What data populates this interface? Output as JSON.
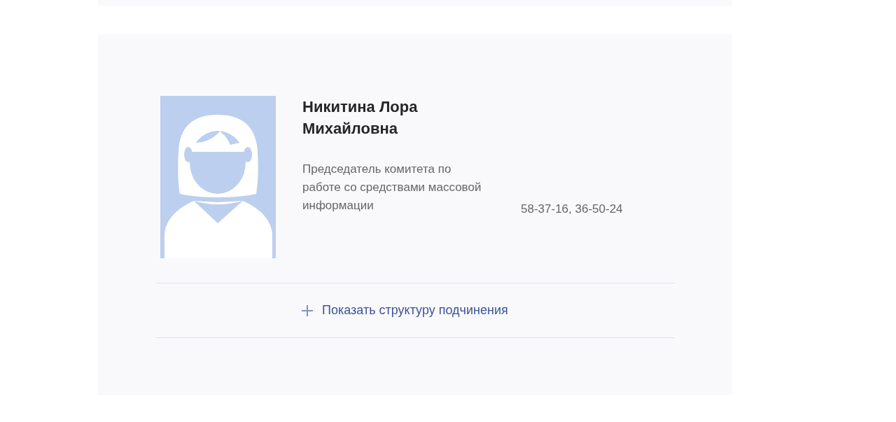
{
  "person": {
    "name": "Никитина Лора Михайловна",
    "position": "Председатель комитета по работе со средствами массовой информации",
    "phone": "58-37-16, 36-50-24"
  },
  "structure_toggle": {
    "label": "Показать структуру подчинения",
    "expanded": false
  }
}
